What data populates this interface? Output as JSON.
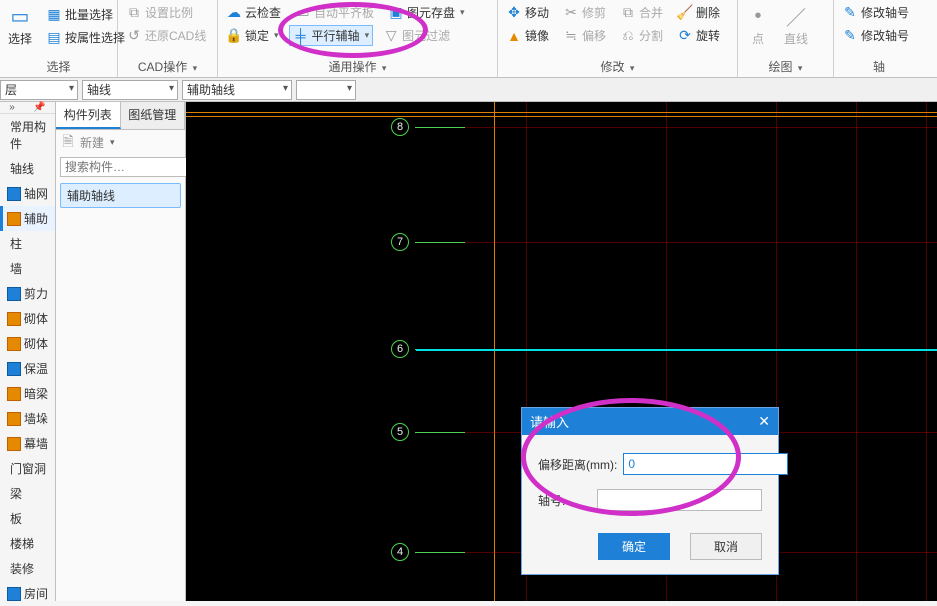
{
  "ribbon": {
    "select_group": {
      "label": "选择",
      "bulk_select": "批量选择",
      "by_attr_select": "按属性选择",
      "pick": "选择"
    },
    "cad_group": {
      "label": "CAD操作",
      "set_scale": "设置比例",
      "restore_cad": "还原CAD线"
    },
    "common_group": {
      "label": "通用操作",
      "cloud_check": "云检查",
      "lock": "锁定",
      "parallel_axis": "平行辅轴",
      "auto": "自动平齐板",
      "elem_store": "图元存盘",
      "elem_filter": "图元过滤"
    },
    "modify_group": {
      "label": "修改",
      "move": "移动",
      "mirror": "镜像",
      "trim": "修剪",
      "offset": "偏移",
      "merge": "合并",
      "split": "分割",
      "delete": "删除",
      "rotate": "旋转"
    },
    "draw_group": {
      "label": "绘图",
      "point": "点",
      "line": "直线"
    },
    "axis_group": {
      "label": "轴",
      "edit_axis1": "修改轴号",
      "edit_axis2": "修改轴号"
    }
  },
  "dropdown_bar": {
    "d0": "层",
    "d1": "轴线",
    "d2": "辅助轴线",
    "d3": ""
  },
  "left_nav": {
    "items": [
      "常用构件",
      "轴线",
      "轴网",
      "辅助",
      "柱",
      "墙",
      "剪力",
      "砌体",
      "砌体",
      "保温",
      "暗梁",
      "墙垛",
      "幕墙",
      "门窗洞",
      "梁",
      "板",
      "楼梯",
      "装修",
      "房间"
    ],
    "active_index": 3
  },
  "panel": {
    "tab1": "构件列表",
    "tab2": "图纸管理",
    "new_btn": "新建",
    "search_placeholder": "搜索构件…",
    "tree_item": "辅助轴线"
  },
  "axis_labels": [
    "8",
    "7",
    "6",
    "5",
    "4"
  ],
  "dialog": {
    "title": "请输入",
    "field1_label": "偏移距离(mm):",
    "field1_value": "0",
    "field2_label": "轴号:",
    "field2_value": "",
    "ok": "确定",
    "cancel": "取消"
  }
}
